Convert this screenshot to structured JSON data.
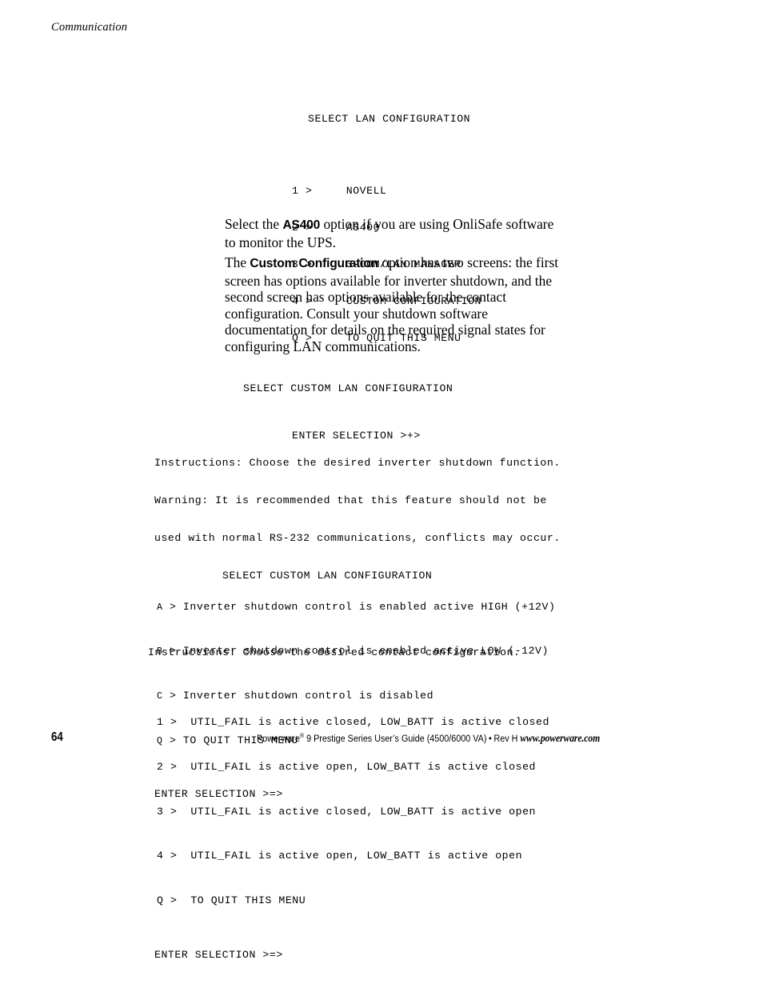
{
  "running_head": "Communication",
  "terminal_blocks": [
    {
      "id": "lan-config",
      "title": "SELECT LAN CONFIGURATION",
      "menu": [
        {
          "key": "1",
          "arrow": ">",
          "label": "NOVELL"
        },
        {
          "key": "2",
          "arrow": ">",
          "label": "AS400"
        },
        {
          "key": "3",
          "arrow": ">",
          "label": "3-COM/LAN MANAGER"
        },
        {
          "key": "4",
          "arrow": ">",
          "label": "CUSTOM CONFIGURATION"
        },
        {
          "key": "Q",
          "arrow": ">",
          "label": "TO QUIT THIS MENU"
        }
      ],
      "prompt": "ENTER SELECTION >+>"
    },
    {
      "id": "custom-inverter",
      "title": "SELECT CUSTOM LAN CONFIGURATION",
      "instructions": [
        "Instructions: Choose the desired inverter shutdown function.",
        "Warning: It is recommended that this feature should not be",
        "used with normal RS-232 communications, conflicts may occur."
      ],
      "options": [
        {
          "key": "A",
          "arrow": ">",
          "label": "Inverter shutdown control is enabled active HIGH (+12V)"
        },
        {
          "key": "B",
          "arrow": ">",
          "label": "Inverter shutdown control is enabled active LOW (-12V)"
        },
        {
          "key": "C",
          "arrow": ">",
          "label": "Inverter shutdown control is disabled"
        },
        {
          "key": "Q",
          "arrow": ">",
          "label": "TO QUIT THIS MENU"
        }
      ],
      "prompt": "ENTER SELECTION >=>"
    },
    {
      "id": "custom-contact",
      "title": "SELECT CUSTOM LAN CONFIGURATION",
      "instructions": [
        "Instructions: Choose the desired contact configuration."
      ],
      "options": [
        {
          "key": "1",
          "arrow": ">",
          "label": "UTIL_FAIL is active closed, LOW_BATT is active closed"
        },
        {
          "key": "2",
          "arrow": ">",
          "label": "UTIL_FAIL is active open, LOW_BATT is active closed"
        },
        {
          "key": "3",
          "arrow": ">",
          "label": "UTIL_FAIL is active closed, LOW_BATT is active open"
        },
        {
          "key": "4",
          "arrow": ">",
          "label": "UTIL_FAIL is active open, LOW_BATT is active open"
        },
        {
          "key": "Q",
          "arrow": ">",
          "label": "TO QUIT THIS MENU"
        }
      ],
      "prompt": "ENTER SELECTION >=>"
    }
  ],
  "paragraphs": {
    "as400": {
      "lead": "Select the ",
      "bold": "AS400",
      "rest": " option if you are using OnliSafe software to monitor the UPS."
    },
    "custom": {
      "lead": "The ",
      "bold": "Custom Configuration",
      "rest": " option has two screens: the first screen has options available for inverter shutdown, and the second screen has options available for the contact configuration. Consult your shutdown software documentation for details on the required signal states for configuring LAN communications."
    }
  },
  "footer": {
    "page_number": "64",
    "product": "Powerware",
    "registered_mark": "®",
    "guide": " 9 Prestige Series User’s Guide (4500/6000 VA)",
    "bullet": "•",
    "revision": "Rev H",
    "url": "www.powerware.com"
  }
}
